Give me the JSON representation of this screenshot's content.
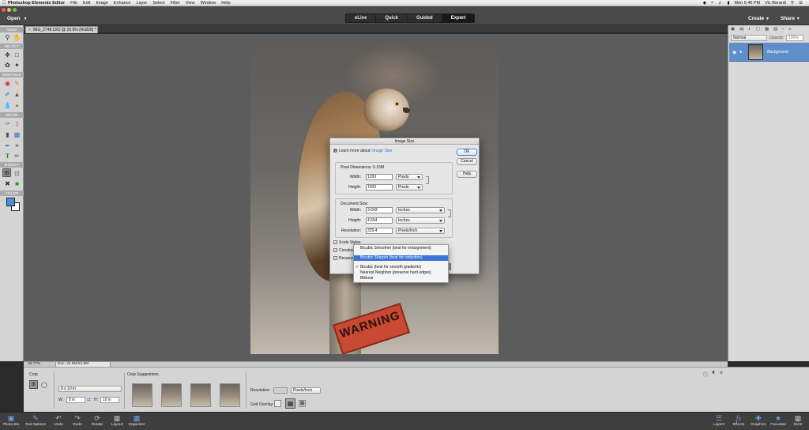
{
  "menubar": {
    "app_name": "Photoshop Elements Editor",
    "items": [
      "File",
      "Edit",
      "Image",
      "Enhance",
      "Layer",
      "Select",
      "Filter",
      "View",
      "Window",
      "Help"
    ],
    "clock": "Mon 6:46 PM",
    "user": "Vic Berardi"
  },
  "topbar": {
    "open_label": "Open",
    "modes": [
      "eLive",
      "Quick",
      "Guided",
      "Expert"
    ],
    "active_mode": "Expert",
    "create_label": "Create",
    "share_label": "Share"
  },
  "document_tab": {
    "title": "IMG_2748.CR2 @ 29.8% (RGB/8) *"
  },
  "toolbox": {
    "sections": [
      "VIEW",
      "SELECT",
      "ENHANCE",
      "DRAW",
      "MODIFY",
      "COLOR"
    ],
    "colors": {
      "foreground": "#4d8ed9",
      "background": "#ffffff"
    }
  },
  "canvas": {
    "sign_text": "WARNING"
  },
  "image_size_dialog": {
    "title": "Image Size",
    "learn_more_label": "Learn more about:",
    "learn_more_link": "Image Size",
    "ok_label": "OK",
    "cancel_label": "Cancel",
    "help_label": "Help",
    "pixel_dimensions_label": "Pixel Dimensions:",
    "pixel_dimensions_value": "5.15M",
    "pixel": {
      "width_label": "Width:",
      "width_value": "1200",
      "width_unit": "Pixels",
      "height_label": "Height:",
      "height_value": "1500",
      "height_unit": "Pixels"
    },
    "document_size_label": "Document Size:",
    "document": {
      "width_label": "Width:",
      "width_value": "3.643",
      "width_unit": "Inches",
      "height_label": "Height:",
      "height_value": "4.554",
      "height_unit": "Inches",
      "resolution_label": "Resolution:",
      "resolution_value": "329.4",
      "resolution_unit": "Pixels/Inch"
    },
    "checkboxes": {
      "scale_styles": "Scale Styles",
      "constrain": "Constrain Proportions",
      "resample": "Resample Image:"
    }
  },
  "resample_menu": {
    "items": [
      "Bicubic Smoother (best for enlargement)",
      "Bicubic Sharper (best for reduction)",
      "Bicubic (best for smooth gradients)",
      "Nearest Neighbor (preserve hard edges)",
      "Bilinear"
    ],
    "highlighted": "Bicubic Sharper (best for reduction)",
    "checked": "Bicubic (best for smooth gradients)"
  },
  "layers_panel": {
    "blend_mode": "Normal",
    "opacity_label": "Opacity:",
    "opacity_value": "100%",
    "layer_name": "Background"
  },
  "status": {
    "zoom": "29.77%",
    "doc_size": "Doc: 24.8M/24.8M"
  },
  "tool_options": {
    "crop_label": "Crop",
    "preset": "8 x 10 in",
    "w_label": "W:",
    "w_value": "8 in",
    "h_label": "H:",
    "h_value": "10 in",
    "suggestions_label": "Crop Suggestions",
    "resolution_label": "Resolution:",
    "resolution_unit": "Pixels/Inch",
    "grid_overlay_label": "Grid Overlay:"
  },
  "bottombar": {
    "left": [
      "Photo Bin",
      "Tool Options",
      "Undo",
      "Redo",
      "Rotate",
      "Layout",
      "Organizer"
    ],
    "right": [
      "Layers",
      "Effects",
      "Graphics",
      "Favorites",
      "More"
    ]
  }
}
